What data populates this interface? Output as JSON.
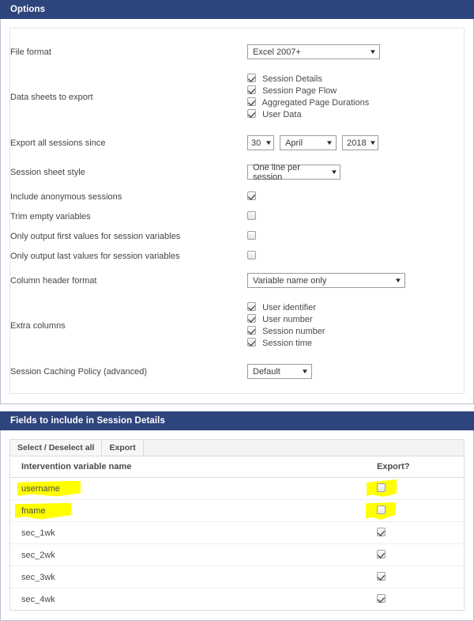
{
  "options_panel": {
    "title": "Options",
    "fields": {
      "file_format": {
        "label": "File format",
        "value": "Excel 2007+"
      },
      "data_sheets": {
        "label": "Data sheets to export",
        "items": [
          {
            "label": "Session Details",
            "checked": true
          },
          {
            "label": "Session Page Flow",
            "checked": true
          },
          {
            "label": "Aggregated Page Durations",
            "checked": true
          },
          {
            "label": "User Data",
            "checked": true
          }
        ]
      },
      "export_since": {
        "label": "Export all sessions since",
        "day": "30",
        "month": "April",
        "year": "2018"
      },
      "sheet_style": {
        "label": "Session sheet style",
        "value": "One line per session"
      },
      "include_anonymous": {
        "label": "Include anonymous sessions",
        "checked": true
      },
      "trim_empty": {
        "label": "Trim empty variables",
        "checked": false
      },
      "first_values": {
        "label": "Only output first values for session variables",
        "checked": false
      },
      "last_values": {
        "label": "Only output last values for session variables",
        "checked": false
      },
      "column_header_format": {
        "label": "Column header format",
        "value": "Variable name only"
      },
      "extra_columns": {
        "label": "Extra columns",
        "items": [
          {
            "label": "User identifier",
            "checked": true
          },
          {
            "label": "User number",
            "checked": true
          },
          {
            "label": "Session number",
            "checked": true
          },
          {
            "label": "Session time",
            "checked": true
          }
        ]
      },
      "caching_policy": {
        "label": "Session Caching Policy (advanced)",
        "value": "Default"
      }
    }
  },
  "fields_panel": {
    "title": "Fields to include in Session Details",
    "tabs": [
      {
        "label": "Select / Deselect all"
      },
      {
        "label": "Export"
      }
    ],
    "columns": {
      "name": "Intervention variable name",
      "export": "Export?"
    },
    "rows": [
      {
        "name": "username",
        "checked": false,
        "highlighted": true
      },
      {
        "name": "fname",
        "checked": false,
        "highlighted": true
      },
      {
        "name": "sec_1wk",
        "checked": true,
        "highlighted": false
      },
      {
        "name": "sec_2wk",
        "checked": true,
        "highlighted": false
      },
      {
        "name": "sec_3wk",
        "checked": true,
        "highlighted": false
      },
      {
        "name": "sec_4wk",
        "checked": true,
        "highlighted": false
      }
    ]
  },
  "colors": {
    "panel_header_bg": "#2e447c",
    "panel_header_text": "#ffffff",
    "highlighter": "#ffff00",
    "body_text": "#4a4a4a"
  }
}
